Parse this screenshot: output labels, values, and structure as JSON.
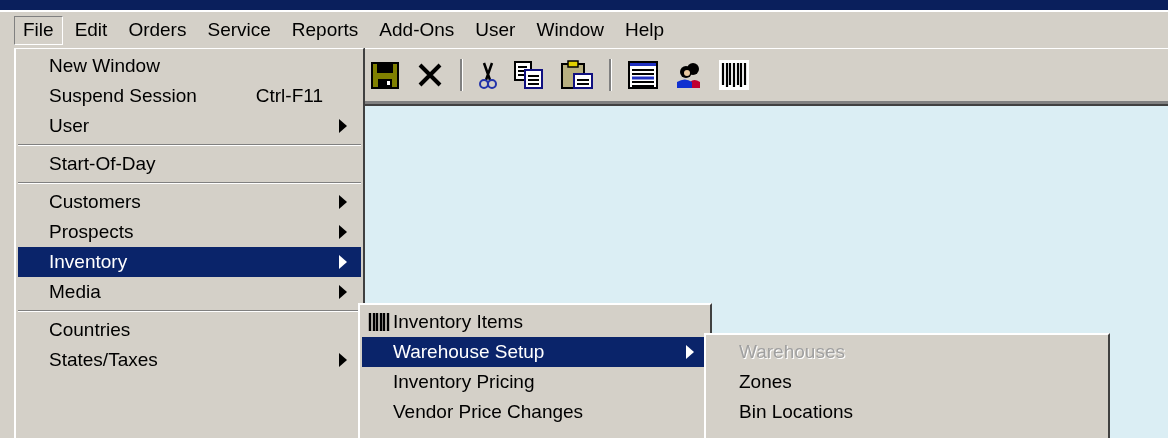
{
  "menu_bar": [
    {
      "label": "File",
      "selected": true
    },
    {
      "label": "Edit",
      "selected": false
    },
    {
      "label": "Orders",
      "selected": false
    },
    {
      "label": "Service",
      "selected": false
    },
    {
      "label": "Reports",
      "selected": false
    },
    {
      "label": "Add-Ons",
      "selected": false
    },
    {
      "label": "User",
      "selected": false
    },
    {
      "label": "Window",
      "selected": false
    },
    {
      "label": "Help",
      "selected": false
    }
  ],
  "file_menu": [
    {
      "kind": "item",
      "label": "New Window",
      "has_submenu": false,
      "selected": false
    },
    {
      "kind": "item",
      "label": "Suspend Session",
      "shortcut": "Ctrl-F11",
      "has_submenu": false,
      "selected": false
    },
    {
      "kind": "item",
      "label": "User",
      "has_submenu": true,
      "selected": false
    },
    {
      "kind": "separator"
    },
    {
      "kind": "item",
      "label": "Start-Of-Day",
      "has_submenu": false,
      "selected": false
    },
    {
      "kind": "separator"
    },
    {
      "kind": "item",
      "label": "Customers",
      "has_submenu": true,
      "selected": false
    },
    {
      "kind": "item",
      "label": "Prospects",
      "has_submenu": true,
      "selected": false
    },
    {
      "kind": "item",
      "label": "Inventory",
      "has_submenu": true,
      "selected": true
    },
    {
      "kind": "item",
      "label": "Media",
      "has_submenu": true,
      "selected": false
    },
    {
      "kind": "separator"
    },
    {
      "kind": "item",
      "label": "Countries",
      "has_submenu": false,
      "selected": false
    },
    {
      "kind": "item",
      "label": "States/Taxes",
      "has_submenu": true,
      "selected": false
    }
  ],
  "inventory_menu": [
    {
      "kind": "icon_item",
      "label": "Inventory Items",
      "has_submenu": false,
      "selected": false
    },
    {
      "kind": "item",
      "label": "Warehouse Setup",
      "has_submenu": true,
      "selected": true
    },
    {
      "kind": "item",
      "label": "Inventory Pricing",
      "has_submenu": false,
      "selected": false
    },
    {
      "kind": "item",
      "label": "Vendor Price Changes",
      "has_submenu": false,
      "selected": false
    }
  ],
  "warehouse_menu": [
    {
      "kind": "item",
      "label": "Warehouses",
      "disabled": true,
      "has_submenu": false,
      "selected": false
    },
    {
      "kind": "item",
      "label": "Zones",
      "disabled": false,
      "has_submenu": false,
      "selected": false
    },
    {
      "kind": "item",
      "label": "Bin Locations",
      "disabled": false,
      "has_submenu": false,
      "selected": false
    }
  ]
}
